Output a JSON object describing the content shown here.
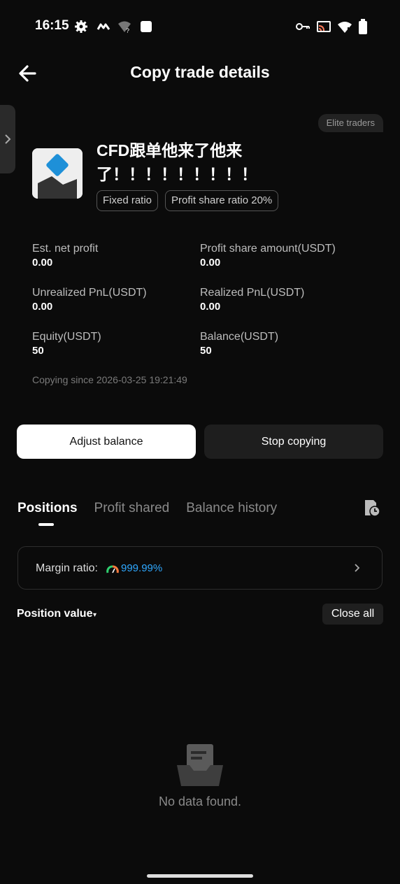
{
  "status_bar": {
    "time": "16:15",
    "icons_left": [
      "gear-icon",
      "app-icon",
      "wifi-question-icon",
      "square-icon"
    ],
    "icons_right": [
      "key-icon",
      "cast-icon",
      "wifi-icon",
      "battery-icon"
    ]
  },
  "header": {
    "title": "Copy trade details",
    "back_icon": "arrow-left-icon"
  },
  "trader": {
    "badge": "Elite traders",
    "name": "CFD跟单他来了他来了！！！！！！！！！",
    "tags": [
      "Fixed ratio",
      "Profit share ratio 20%"
    ]
  },
  "stats": {
    "est_net_profit_label": "Est. net profit",
    "est_net_profit_value": "0.00",
    "profit_share_label": "Profit share amount(USDT)",
    "profit_share_value": "0.00",
    "unrealized_label": "Unrealized PnL(USDT)",
    "unrealized_value": "0.00",
    "realized_label": "Realized PnL(USDT)",
    "realized_value": "0.00",
    "equity_label": "Equity(USDT)",
    "equity_value": "50",
    "balance_label": "Balance(USDT)",
    "balance_value": "50",
    "copying_since": "Copying since 2026-03-25 19:21:49"
  },
  "actions": {
    "adjust_label": "Adjust balance",
    "stop_label": "Stop copying"
  },
  "tabs": {
    "items": [
      "Positions",
      "Profit shared",
      "Balance history"
    ],
    "active": "Positions"
  },
  "margin": {
    "label": "Margin ratio:",
    "value": "999.99%",
    "value_color": "#2fa8ff"
  },
  "positions": {
    "sort_label": "Position value",
    "caret": "▾",
    "close_all_label": "Close all"
  },
  "empty_state": {
    "text": "No data found."
  }
}
